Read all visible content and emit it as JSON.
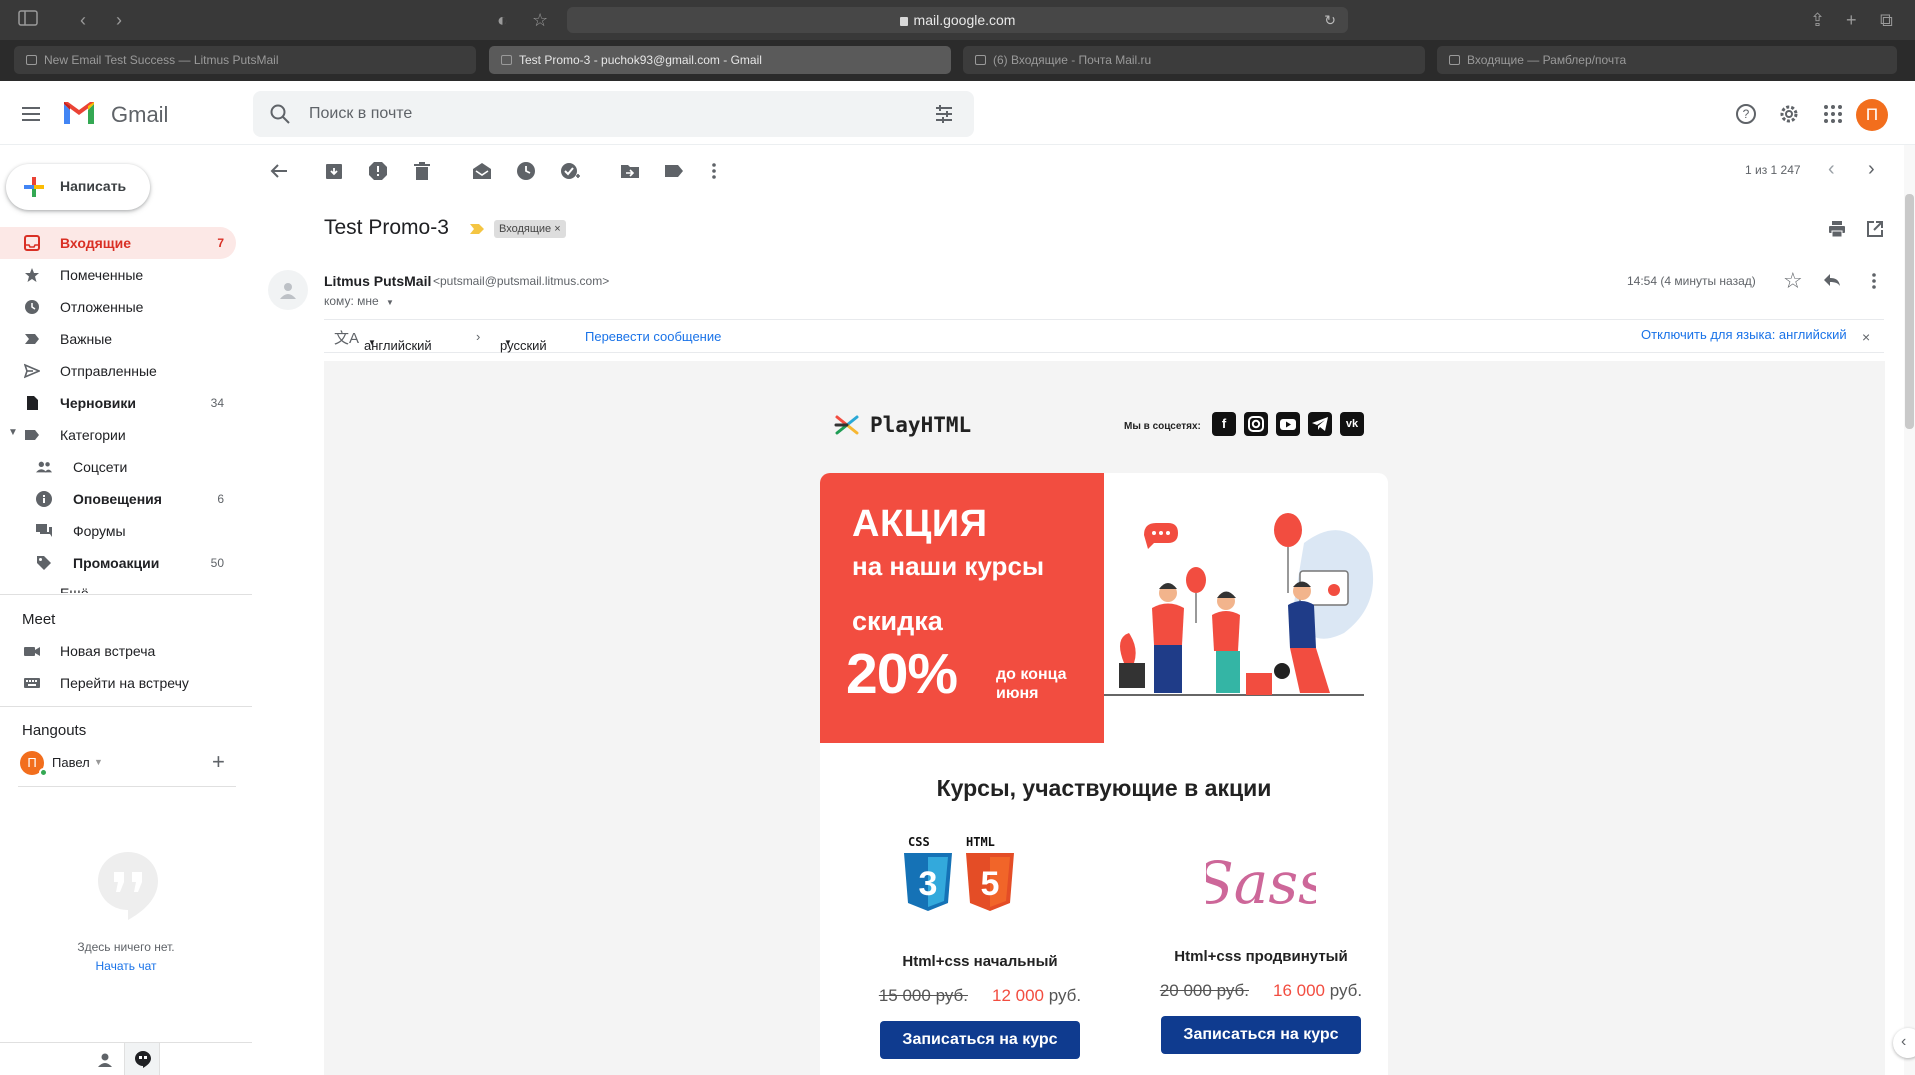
{
  "browser": {
    "url": "mail.google.com",
    "tabs": [
      {
        "label": "New Email Test Success — Litmus PutsMail",
        "active": false
      },
      {
        "label": "Test Promo-3 - puchok93@gmail.com - Gmail",
        "active": true
      },
      {
        "label": "(6) Входящие - Почта Mail.ru",
        "active": false
      },
      {
        "label": "Входящие — Рамблер/почта",
        "active": false
      }
    ]
  },
  "header": {
    "app_name": "Gmail",
    "search_placeholder": "Поиск в почте",
    "avatar_letter": "П",
    "avatar_color": "#f26e1d"
  },
  "sidebar": {
    "compose_label": "Написать",
    "items": [
      {
        "label": "Входящие",
        "count": "7",
        "icon": "inbox-icon"
      },
      {
        "label": "Помеченные",
        "count": "",
        "icon": "star-icon"
      },
      {
        "label": "Отложенные",
        "count": "",
        "icon": "clock-icon"
      },
      {
        "label": "Важные",
        "count": "",
        "icon": "important-icon"
      },
      {
        "label": "Отправленные",
        "count": "",
        "icon": "send-icon"
      },
      {
        "label": "Черновики",
        "count": "34",
        "icon": "draft-icon"
      },
      {
        "label": "Категории",
        "count": "",
        "icon": "label-icon"
      },
      {
        "label": "Соцсети",
        "count": "",
        "icon": "people-icon"
      },
      {
        "label": "Оповещения",
        "count": "6",
        "icon": "info-icon"
      },
      {
        "label": "Форумы",
        "count": "",
        "icon": "forum-icon"
      },
      {
        "label": "Промоакции",
        "count": "50",
        "icon": "tag-icon"
      },
      {
        "label": "Ещё",
        "count": "",
        "icon": "chevron-down-icon"
      }
    ],
    "meet_title": "Meet",
    "meet_items": [
      "Новая встреча",
      "Перейти на встречу"
    ],
    "hangouts_title": "Hangouts",
    "hangouts_user": "Павел",
    "hangouts_avatar_letter": "П",
    "empty_text": "Здесь ничего нет.",
    "start_chat": "Начать чат"
  },
  "toolbar": {
    "pager": "1 из 1 247"
  },
  "message": {
    "subject": "Test Promo-3",
    "label": "Входящие",
    "sender_name": "Litmus PutsMail",
    "sender_email": "<putsmail@putsmail.litmus.com>",
    "to": "кому: мне",
    "time": "14:54 (4 минуты назад)",
    "translate": {
      "from": "английский",
      "to": "русский",
      "action": "Перевести сообщение",
      "disable": "Отключить для языка: английский"
    }
  },
  "email": {
    "logo": "PlayHTML",
    "social_label": "Мы в соцсетях:",
    "socials": [
      "f",
      "ig",
      "yt",
      "tg",
      "vk"
    ],
    "hero": {
      "line1": "АКЦИЯ",
      "line2": "на наши курсы",
      "line3": "скидка",
      "percent": "20%",
      "line4": "до конца июня"
    },
    "accent_color": "#f24d40",
    "button_color": "#0f3b8f",
    "courses_title": "Курсы, участвующие в акции",
    "courses": [
      {
        "logo_css": "CSS",
        "logo_html": "HTML",
        "name": "Html+css начальный",
        "old_price": "15 000 руб.",
        "new_price": "12 000",
        "currency": "руб.",
        "button": "Записаться на курс"
      },
      {
        "logo_sass": "Sass",
        "name": "Html+css продвинутый",
        "old_price": "20 000 руб.",
        "new_price": "16 000",
        "currency": "руб.",
        "button": "Записаться на курс"
      }
    ]
  }
}
